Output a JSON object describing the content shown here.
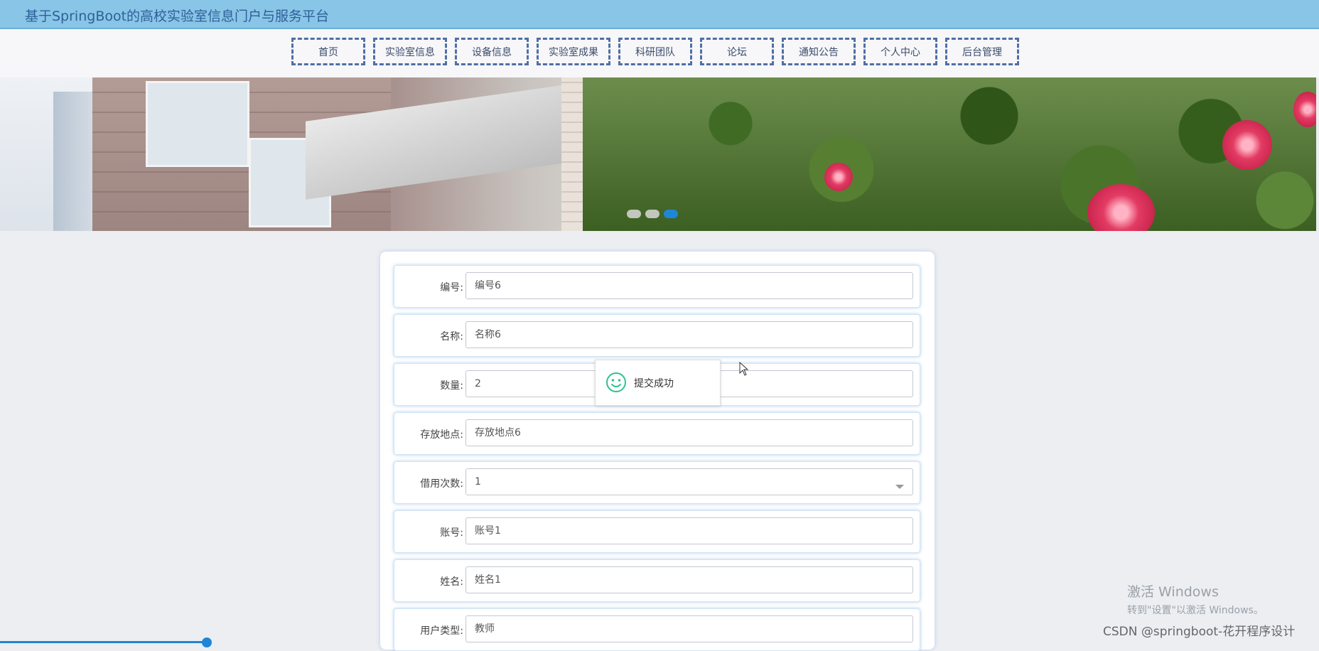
{
  "header": {
    "title": "基于SpringBoot的高校实验室信息门户与服务平台"
  },
  "nav": {
    "items": [
      "首页",
      "实验室信息",
      "设备信息",
      "实验室成果",
      "科研团队",
      "论坛",
      "通知公告",
      "个人中心",
      "后台管理"
    ]
  },
  "banner": {
    "active_slide": 3,
    "slide_count": 3
  },
  "form": {
    "fields": [
      {
        "label": "编号:",
        "value": "编号6",
        "type": "text"
      },
      {
        "label": "名称:",
        "value": "名称6",
        "type": "text"
      },
      {
        "label": "数量:",
        "value": "2",
        "type": "text"
      },
      {
        "label": "存放地点:",
        "value": "存放地点6",
        "type": "text"
      },
      {
        "label": "借用次数:",
        "value": "1",
        "type": "select"
      },
      {
        "label": "账号:",
        "value": "账号1",
        "type": "text"
      },
      {
        "label": "姓名:",
        "value": "姓名1",
        "type": "text"
      },
      {
        "label": "用户类型:",
        "value": "教师",
        "type": "text"
      }
    ]
  },
  "toast": {
    "message": "提交成功",
    "icon": "smile-icon"
  },
  "watermark": {
    "activate_title": "激活 Windows",
    "activate_sub": "转到\"设置\"以激活 Windows。",
    "csdn": "CSDN @springboot-花开程序设计"
  },
  "video_progress": 0.157,
  "colors": {
    "header_bg": "#88c5e6",
    "accent": "#1e86d6",
    "nav_border": "#4f6fa5"
  }
}
